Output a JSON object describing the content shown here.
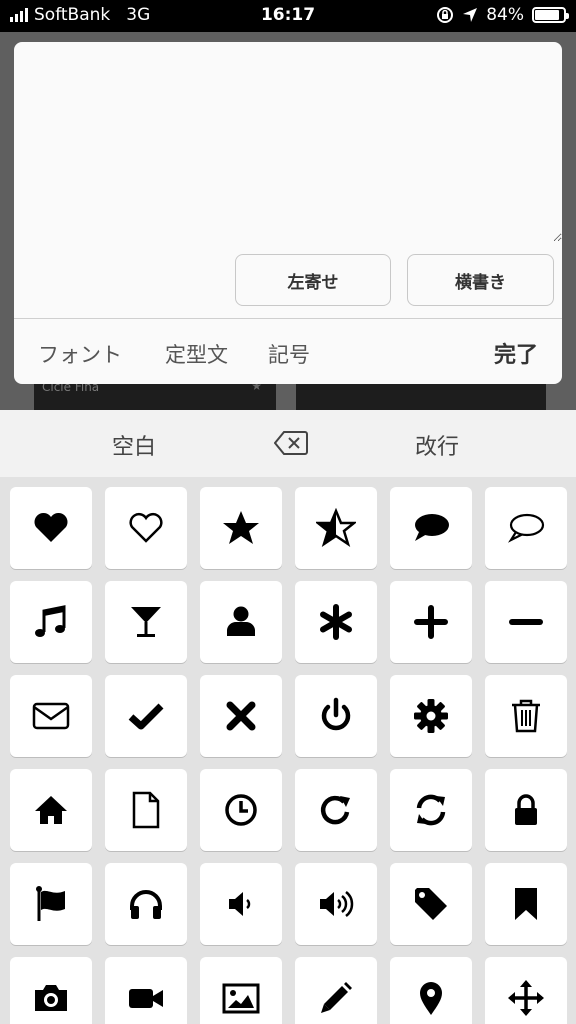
{
  "status_bar": {
    "carrier": "SoftBank",
    "network": "3G",
    "time": "16:17",
    "battery": "84%",
    "battery_level": 0.84,
    "icons": [
      "signal-icon",
      "orientation-lock-icon",
      "location-arrow-icon",
      "battery-icon"
    ]
  },
  "background": {
    "card_left_text": "Cicle Fina"
  },
  "editor": {
    "text_value": "",
    "align_button": "左寄せ",
    "direction_button": "横書き"
  },
  "toolbar": {
    "font_tab": "フォント",
    "template_tab": "定型文",
    "symbol_tab": "記号",
    "done": "完了"
  },
  "keyboard": {
    "space": "空白",
    "delete_icon": "backspace-icon",
    "return": "改行",
    "symbols": [
      "heart-icon",
      "heart-outline-icon",
      "star-icon",
      "star-half-icon",
      "speech-bubble-icon",
      "speech-bubble-outline-icon",
      "music-note-icon",
      "cocktail-glass-icon",
      "user-icon",
      "asterisk-icon",
      "plus-icon",
      "minus-icon",
      "envelope-icon",
      "checkmark-icon",
      "x-mark-icon",
      "power-icon",
      "gear-icon",
      "trash-icon",
      "home-icon",
      "document-icon",
      "clock-icon",
      "redo-icon",
      "refresh-icon",
      "lock-icon",
      "flag-icon",
      "headphones-icon",
      "speaker-low-icon",
      "speaker-high-icon",
      "tag-icon",
      "bookmark-icon",
      "camera-icon",
      "video-camera-icon",
      "image-icon",
      "pencil-icon",
      "map-pin-icon",
      "move-arrows-icon"
    ]
  }
}
